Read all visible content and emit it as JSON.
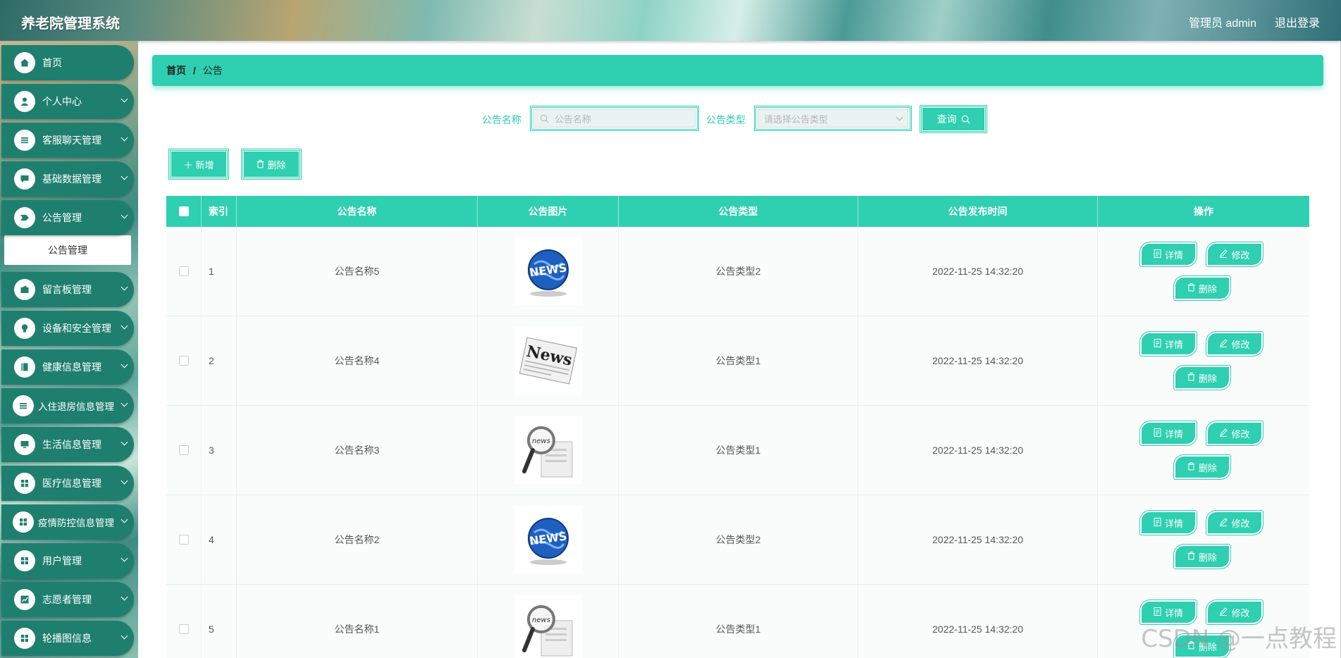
{
  "app": {
    "title": "养老院管理系统"
  },
  "header": {
    "user": "管理员 admin",
    "logout": "退出登录"
  },
  "sidebar": {
    "items": [
      {
        "label": "首页",
        "icon": "home-icon",
        "has_children": false
      },
      {
        "label": "个人中心",
        "icon": "user-icon",
        "has_children": true
      },
      {
        "label": "客服聊天管理",
        "icon": "list-icon",
        "has_children": true
      },
      {
        "label": "基础数据管理",
        "icon": "chat-icon",
        "has_children": true
      },
      {
        "label": "公告管理",
        "icon": "tag-icon",
        "has_children": true,
        "expanded": true
      },
      {
        "label": "留言板管理",
        "icon": "wallet-icon",
        "has_children": true
      },
      {
        "label": "设备和安全管理",
        "icon": "bulb-icon",
        "has_children": true
      },
      {
        "label": "健康信息管理",
        "icon": "book-icon",
        "has_children": true
      },
      {
        "label": "入住退房信息管理",
        "icon": "list-icon",
        "has_children": true
      },
      {
        "label": "生活信息管理",
        "icon": "monitor-icon",
        "has_children": true
      },
      {
        "label": "医疗信息管理",
        "icon": "grid-icon",
        "has_children": true
      },
      {
        "label": "疫情防控信息管理",
        "icon": "grid-icon",
        "has_children": true
      },
      {
        "label": "用户管理",
        "icon": "grid-icon",
        "has_children": true
      },
      {
        "label": "志愿者管理",
        "icon": "chart-icon",
        "has_children": true
      },
      {
        "label": "轮播图信息",
        "icon": "grid-icon",
        "has_children": true
      }
    ],
    "submenu": {
      "label": "公告管理"
    }
  },
  "breadcrumb": {
    "home": "首页",
    "sep": "/",
    "current": "公告"
  },
  "search": {
    "name_label": "公告名称",
    "name_placeholder": "公告名称",
    "type_label": "公告类型",
    "type_placeholder": "请选择公告类型",
    "query_label": "查询"
  },
  "toolbar": {
    "add_label": "新增",
    "delete_label": "删除"
  },
  "table": {
    "columns": [
      "索引",
      "公告名称",
      "公告图片",
      "公告类型",
      "公告发布时间",
      "操作"
    ],
    "rows": [
      {
        "index": "1",
        "name": "公告名称5",
        "image": "globe-news",
        "type": "公告类型2",
        "time": "2022-11-25 14:32:20"
      },
      {
        "index": "2",
        "name": "公告名称4",
        "image": "newspaper-news",
        "type": "公告类型1",
        "time": "2022-11-25 14:32:20"
      },
      {
        "index": "3",
        "name": "公告名称3",
        "image": "magnifier-news",
        "type": "公告类型1",
        "time": "2022-11-25 14:32:20"
      },
      {
        "index": "4",
        "name": "公告名称2",
        "image": "globe-news",
        "type": "公告类型2",
        "time": "2022-11-25 14:32:20"
      },
      {
        "index": "5",
        "name": "公告名称1",
        "image": "magnifier-news",
        "type": "公告类型1",
        "time": "2022-11-25 14:32:20"
      }
    ],
    "actions": {
      "detail": "详情",
      "edit": "修改",
      "delete": "删除"
    }
  },
  "watermark": "CSDN @一点教程",
  "colors": {
    "accent": "#2fcfb1",
    "sidebar_item": "#1f7f6f"
  }
}
